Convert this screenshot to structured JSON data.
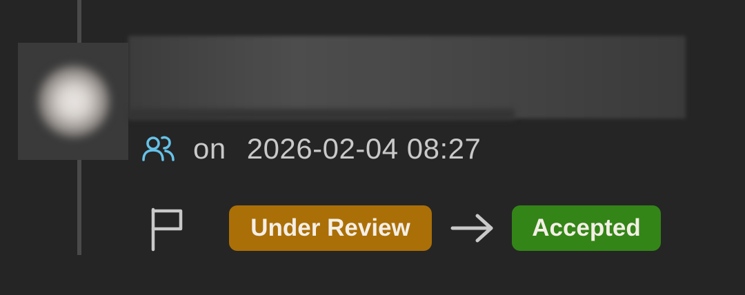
{
  "event": {
    "actor_icon": "users-icon",
    "on_label": "on",
    "timestamp": "2026-02-04 08:27"
  },
  "status_change": {
    "flag_icon": "flag-icon",
    "from_status": "Under Review",
    "arrow_icon": "arrow-right-icon",
    "to_status": "Accepted",
    "from_color": "#ab6f07",
    "to_color": "#338517"
  },
  "colors": {
    "background": "#252525",
    "timeline": "#4a4a4a",
    "icon_accent": "#66c2e8",
    "text_muted": "#c9c9c9"
  }
}
